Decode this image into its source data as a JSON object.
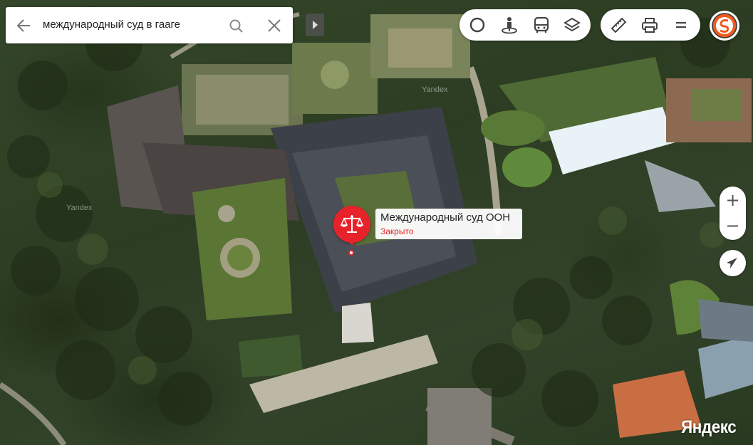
{
  "search": {
    "query": "международный суд в гааге"
  },
  "icons": {
    "back": "arrow-left-icon",
    "search": "magnifier-icon",
    "clear": "close-icon",
    "collapse": "play-triangle-icon",
    "traffic": "traffic-circle-icon",
    "panorama": "street-view-icon",
    "transit": "bus-icon",
    "layers": "layers-icon",
    "ruler": "ruler-icon",
    "print": "printer-icon",
    "menu": "menu-icon",
    "profile": "service-logo-icon",
    "locate": "locate-arrow-icon",
    "place": "scales-of-justice-icon"
  },
  "map_controls": {
    "zoom_in": "+",
    "zoom_out": "−"
  },
  "place": {
    "name": "Международный суд ООН",
    "status": "Закрыто"
  },
  "watermarks": [
    "Yandex",
    "Yandex"
  ],
  "brand": "Яндекс",
  "colors": {
    "pin": "#e8222a",
    "status_closed": "#e8222a",
    "logo_orange": "#ef5a1e"
  }
}
